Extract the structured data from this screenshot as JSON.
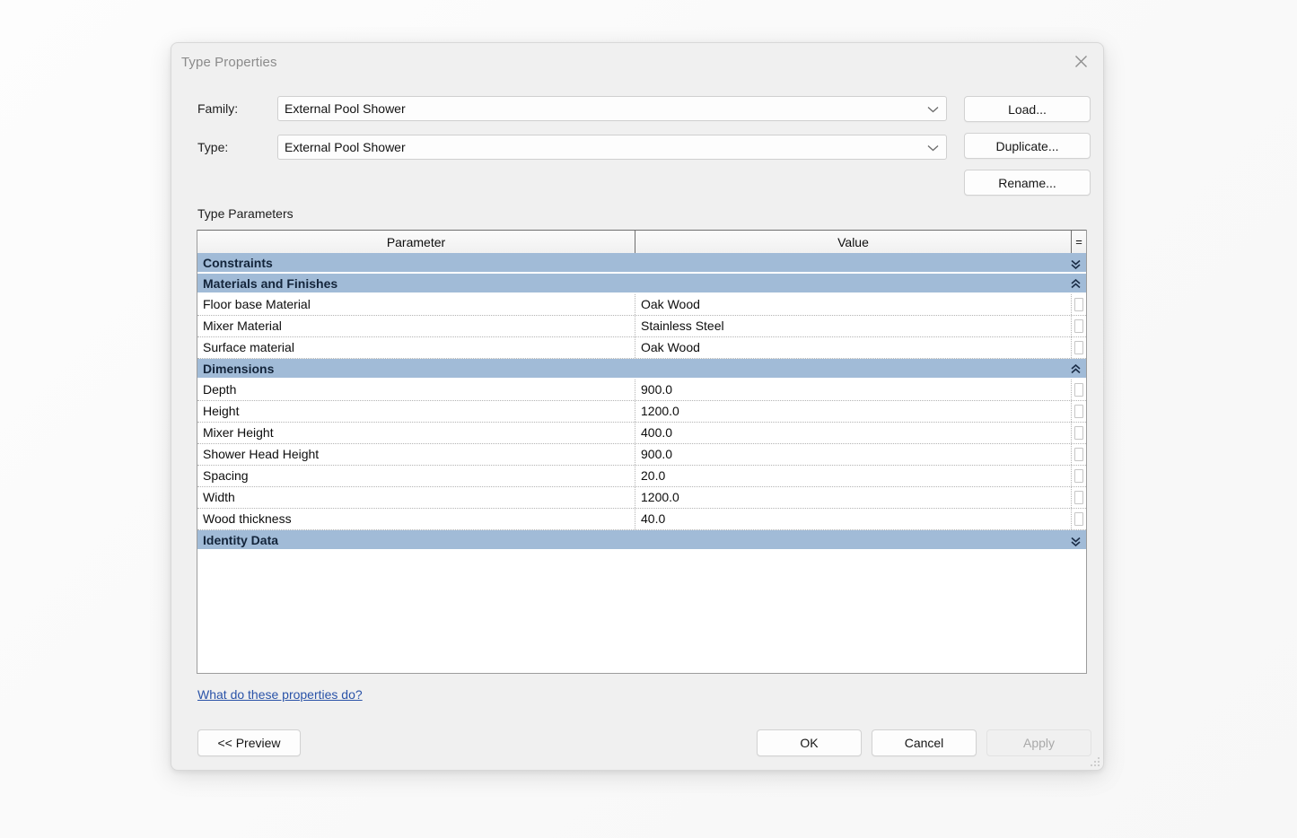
{
  "window": {
    "title": "Type Properties",
    "close_icon": "close-icon"
  },
  "form": {
    "family_label": "Family:",
    "family_value": "External Pool Shower",
    "type_label": "Type:",
    "type_value": "External Pool Shower",
    "dropdown_icon": "chevron-down-icon"
  },
  "side_buttons": [
    {
      "label": "Load..."
    },
    {
      "label": "Duplicate..."
    },
    {
      "label": "Rename..."
    }
  ],
  "parameters": {
    "section_label": "Type Parameters",
    "columns": {
      "parameter": "Parameter",
      "value": "Value",
      "formula": "="
    },
    "groups": [
      {
        "name": "Constraints",
        "expanded": false,
        "chevron_icon": "double-chevron-down-icon",
        "rows": []
      },
      {
        "name": "Materials and Finishes",
        "expanded": true,
        "chevron_icon": "double-chevron-up-icon",
        "rows": [
          {
            "parameter": "Floor base Material",
            "value": "Oak Wood"
          },
          {
            "parameter": "Mixer Material",
            "value": "Stainless Steel"
          },
          {
            "parameter": "Surface material",
            "value": "Oak Wood"
          }
        ]
      },
      {
        "name": "Dimensions",
        "expanded": true,
        "chevron_icon": "double-chevron-up-icon",
        "rows": [
          {
            "parameter": "Depth",
            "value": "900.0"
          },
          {
            "parameter": "Height",
            "value": "1200.0"
          },
          {
            "parameter": "Mixer Height",
            "value": "400.0"
          },
          {
            "parameter": "Shower Head Height",
            "value": "900.0"
          },
          {
            "parameter": "Spacing",
            "value": "20.0"
          },
          {
            "parameter": "Width",
            "value": "1200.0"
          },
          {
            "parameter": "Wood thickness",
            "value": "40.0"
          }
        ]
      },
      {
        "name": "Identity Data",
        "expanded": false,
        "chevron_icon": "double-chevron-down-icon",
        "rows": []
      }
    ]
  },
  "footer": {
    "help_link": "What do these properties do?",
    "preview_label": "<< Preview",
    "ok_label": "OK",
    "cancel_label": "Cancel",
    "apply_label": "Apply",
    "apply_disabled": true
  },
  "colors": {
    "group_header_bg": "#a1bbd7",
    "group_header_text": "#13243a",
    "link": "#2a53a8",
    "dialog_bg": "#f0f0f0",
    "table_bg": "#ffffff"
  }
}
